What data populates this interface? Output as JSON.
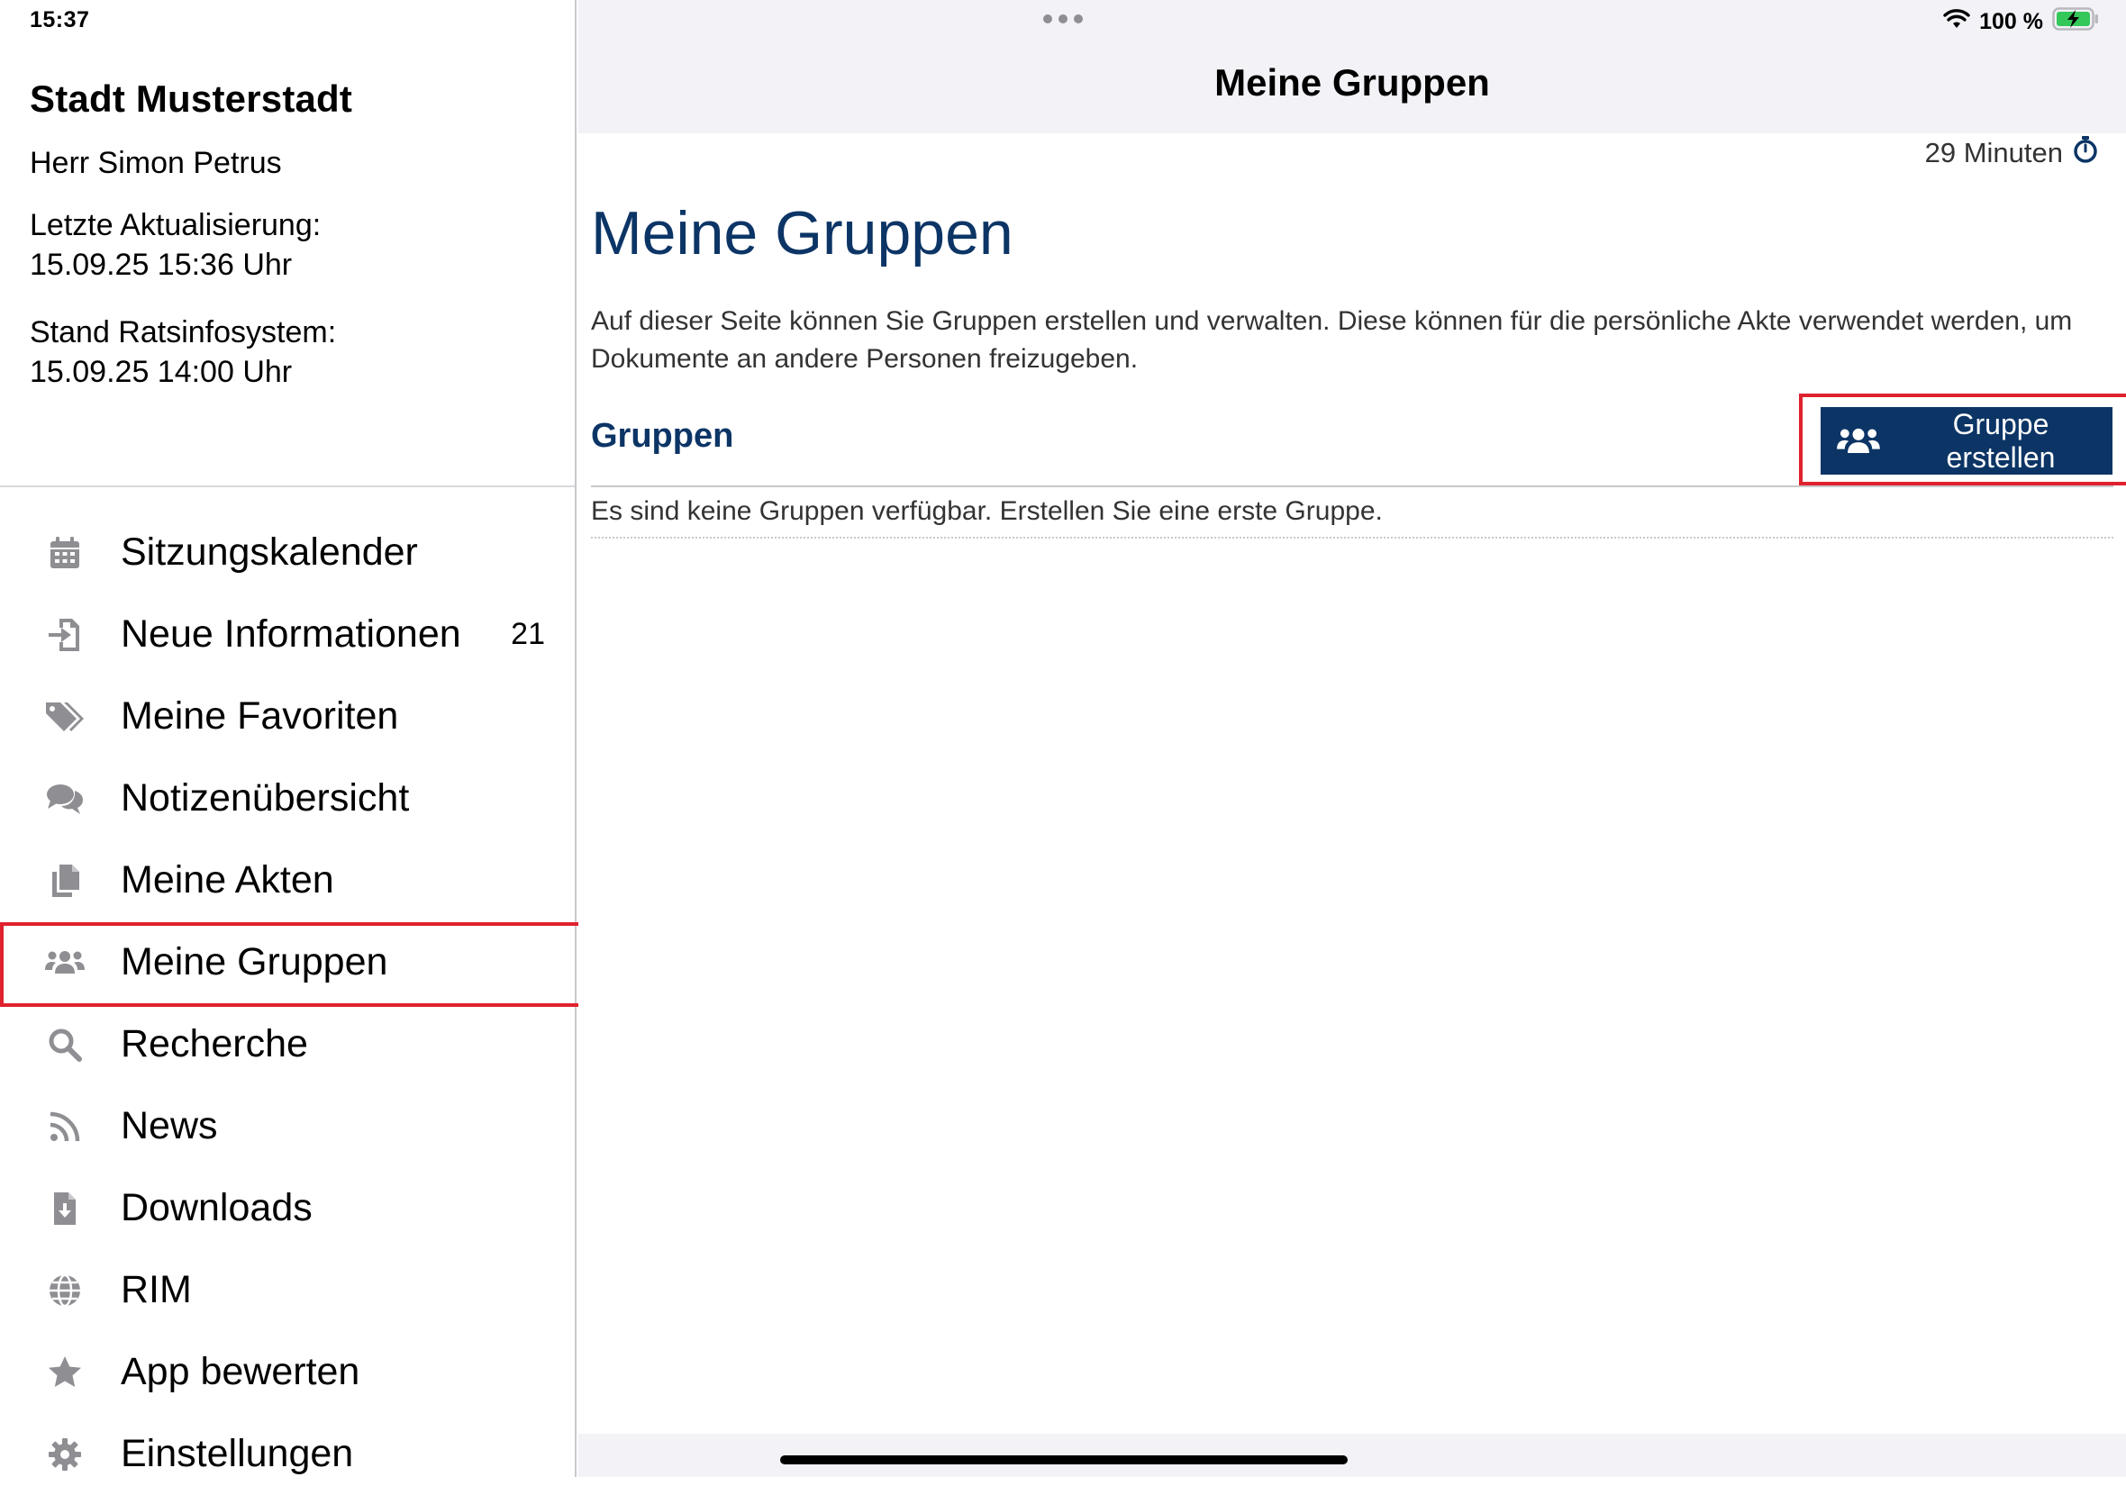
{
  "status_bar": {
    "time": "15:37",
    "battery": "100 %"
  },
  "sidebar": {
    "org_name": "Stadt Musterstadt",
    "user_name": "Herr Simon Petrus",
    "last_update_label": "Letzte Aktualisierung:",
    "last_update_value": "15.09.25 15:36 Uhr",
    "ris_label": "Stand Ratsinfosystem:",
    "ris_value": "15.09.25 14:00 Uhr",
    "items": [
      {
        "label": "Sitzungskalender",
        "icon": "calendar-icon"
      },
      {
        "label": "Neue Informationen",
        "icon": "import-icon",
        "count": "21"
      },
      {
        "label": "Meine Favoriten",
        "icon": "tags-icon"
      },
      {
        "label": "Notizenübersicht",
        "icon": "comments-icon"
      },
      {
        "label": "Meine Akten",
        "icon": "copy-icon"
      },
      {
        "label": "Meine Gruppen",
        "icon": "users-icon",
        "active": true
      },
      {
        "label": "Recherche",
        "icon": "search-icon"
      },
      {
        "label": "News",
        "icon": "rss-icon"
      },
      {
        "label": "Downloads",
        "icon": "file-download-icon"
      },
      {
        "label": "RIM",
        "icon": "globe-icon"
      },
      {
        "label": "App bewerten",
        "icon": "star-icon"
      },
      {
        "label": "Einstellungen",
        "icon": "gear-icon"
      }
    ]
  },
  "main": {
    "nav_title": "Meine Gruppen",
    "timer_text": "29 Minuten",
    "heading": "Meine Gruppen",
    "description": "Auf dieser Seite können Sie Gruppen erstellen und verwalten. Diese können für die persönliche Akte verwendet werden, um Dokumente an andere Personen freizugeben.",
    "section_title": "Gruppen",
    "create_button_label": "Gruppe erstellen",
    "empty_message": "Es sind keine Gruppen verfügbar. Erstellen Sie eine erste Gruppe."
  },
  "colors": {
    "brand_navy": "#0c3566",
    "highlight_red": "#e0212e",
    "icon_gray": "#8e8e93"
  }
}
